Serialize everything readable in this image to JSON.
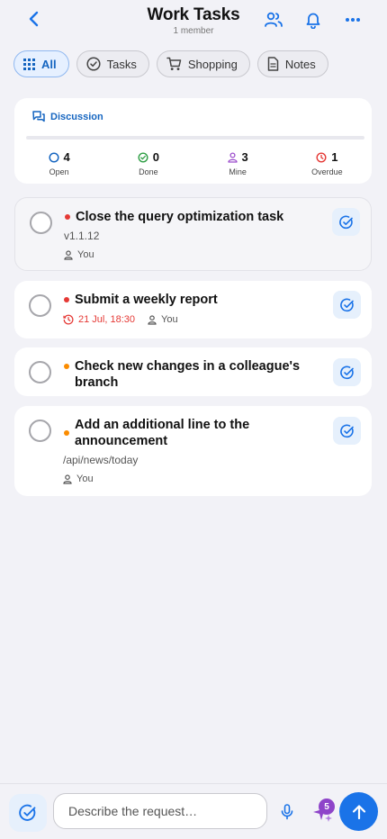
{
  "header": {
    "title": "Work Tasks",
    "subtitle": "1 member"
  },
  "filters": [
    {
      "label": "All",
      "icon": "grid-icon",
      "active": true
    },
    {
      "label": "Tasks",
      "icon": "check-circle-icon",
      "active": false
    },
    {
      "label": "Shopping",
      "icon": "cart-icon",
      "active": false
    },
    {
      "label": "Notes",
      "icon": "note-icon",
      "active": false
    }
  ],
  "discussion": {
    "label": "Discussion",
    "stats": [
      {
        "value": "4",
        "label": "Open",
        "color": "#1565c0"
      },
      {
        "value": "0",
        "label": "Done",
        "color": "#2e9e44"
      },
      {
        "value": "3",
        "label": "Mine",
        "color": "#9c4dcc"
      },
      {
        "value": "1",
        "label": "Overdue",
        "color": "#e53935"
      }
    ]
  },
  "tasks": [
    {
      "title": "Close the query optimization task",
      "subtitle": "v1.1.12",
      "assignee": "You",
      "priority_color": "#e53935"
    },
    {
      "title": "Submit a weekly report",
      "due": "21 Jul, 18:30",
      "assignee": "You",
      "priority_color": "#e53935"
    },
    {
      "title": "Check new changes in a colleague's branch",
      "priority_color": "#fb8c00"
    },
    {
      "title": "Add an additional line to the announcement",
      "subtitle": "/api/news/today",
      "assignee": "You",
      "priority_color": "#fb8c00"
    }
  ],
  "bottom": {
    "placeholder": "Describe the request…",
    "badge": "5"
  },
  "colors": {
    "accent": "#1a73e8",
    "background": "#f2f2f7"
  }
}
